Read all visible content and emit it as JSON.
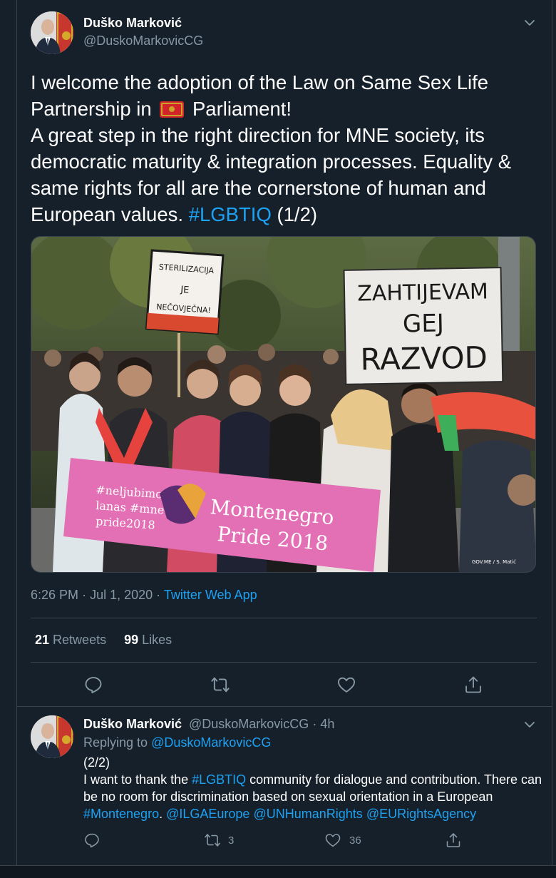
{
  "tweet": {
    "author_name": "Duško Marković",
    "author_handle": "@DuskoMarkovicCG",
    "text_line1_a": "I welcome the adoption of the Law on Same Sex Life",
    "text_line2_a": "Partnership in",
    "flag_icon": "montenegro-flag",
    "text_line2_b": "Parliament!",
    "text_rest": "A great step in the right direction for MNE society, its democratic maturity & integration processes. Equality & same rights for all are the cornerstone of human and European values.",
    "hashtag": "#LGBTIQ",
    "suffix": "(1/2)",
    "photo": {
      "sign_left": [
        "STERILIZACIJA",
        "JE",
        "NEČOVJEČNA!"
      ],
      "sign_right": [
        "ZAHTIJEVAM",
        "GEJ",
        "RAZVOD"
      ],
      "banner_left": [
        "#neljubimo",
        "lanas #mne",
        "pride2018"
      ],
      "banner_right": [
        "Montenegro",
        "Pride 2018"
      ],
      "credit": "GOV.ME / S. Matić"
    },
    "time": "6:26 PM",
    "date": "Jul 1, 2020",
    "separator": "·",
    "source_app": "Twitter Web App",
    "retweets_count": "21",
    "retweets_label": "Retweets",
    "likes_count": "99",
    "likes_label": "Likes"
  },
  "reply": {
    "author_name": "Duško Marković",
    "author_handle": "@DuskoMarkovicCG",
    "age": "4h",
    "separator": "·",
    "replying_label": "Replying to",
    "replying_to": "@DuskoMarkovicCG",
    "line1": "(2/2)",
    "text_a": "I want to thank the",
    "hashtag1": "#LGBTIQ",
    "text_b": "community for dialogue and contribution. There can be no room for discrimination based on sexual orientation in a European",
    "hashtag2": "#Montenegro",
    "text_c": ".",
    "mention1": "@ILGAEurope",
    "mention2": "@UNHumanRights",
    "mention3": "@EURightsAgency",
    "retweet_count": "3",
    "like_count": "36"
  },
  "colors": {
    "background": "#15202b",
    "accent": "#1da1f2",
    "secondary_text": "#8899a6",
    "divider": "#38444d"
  }
}
